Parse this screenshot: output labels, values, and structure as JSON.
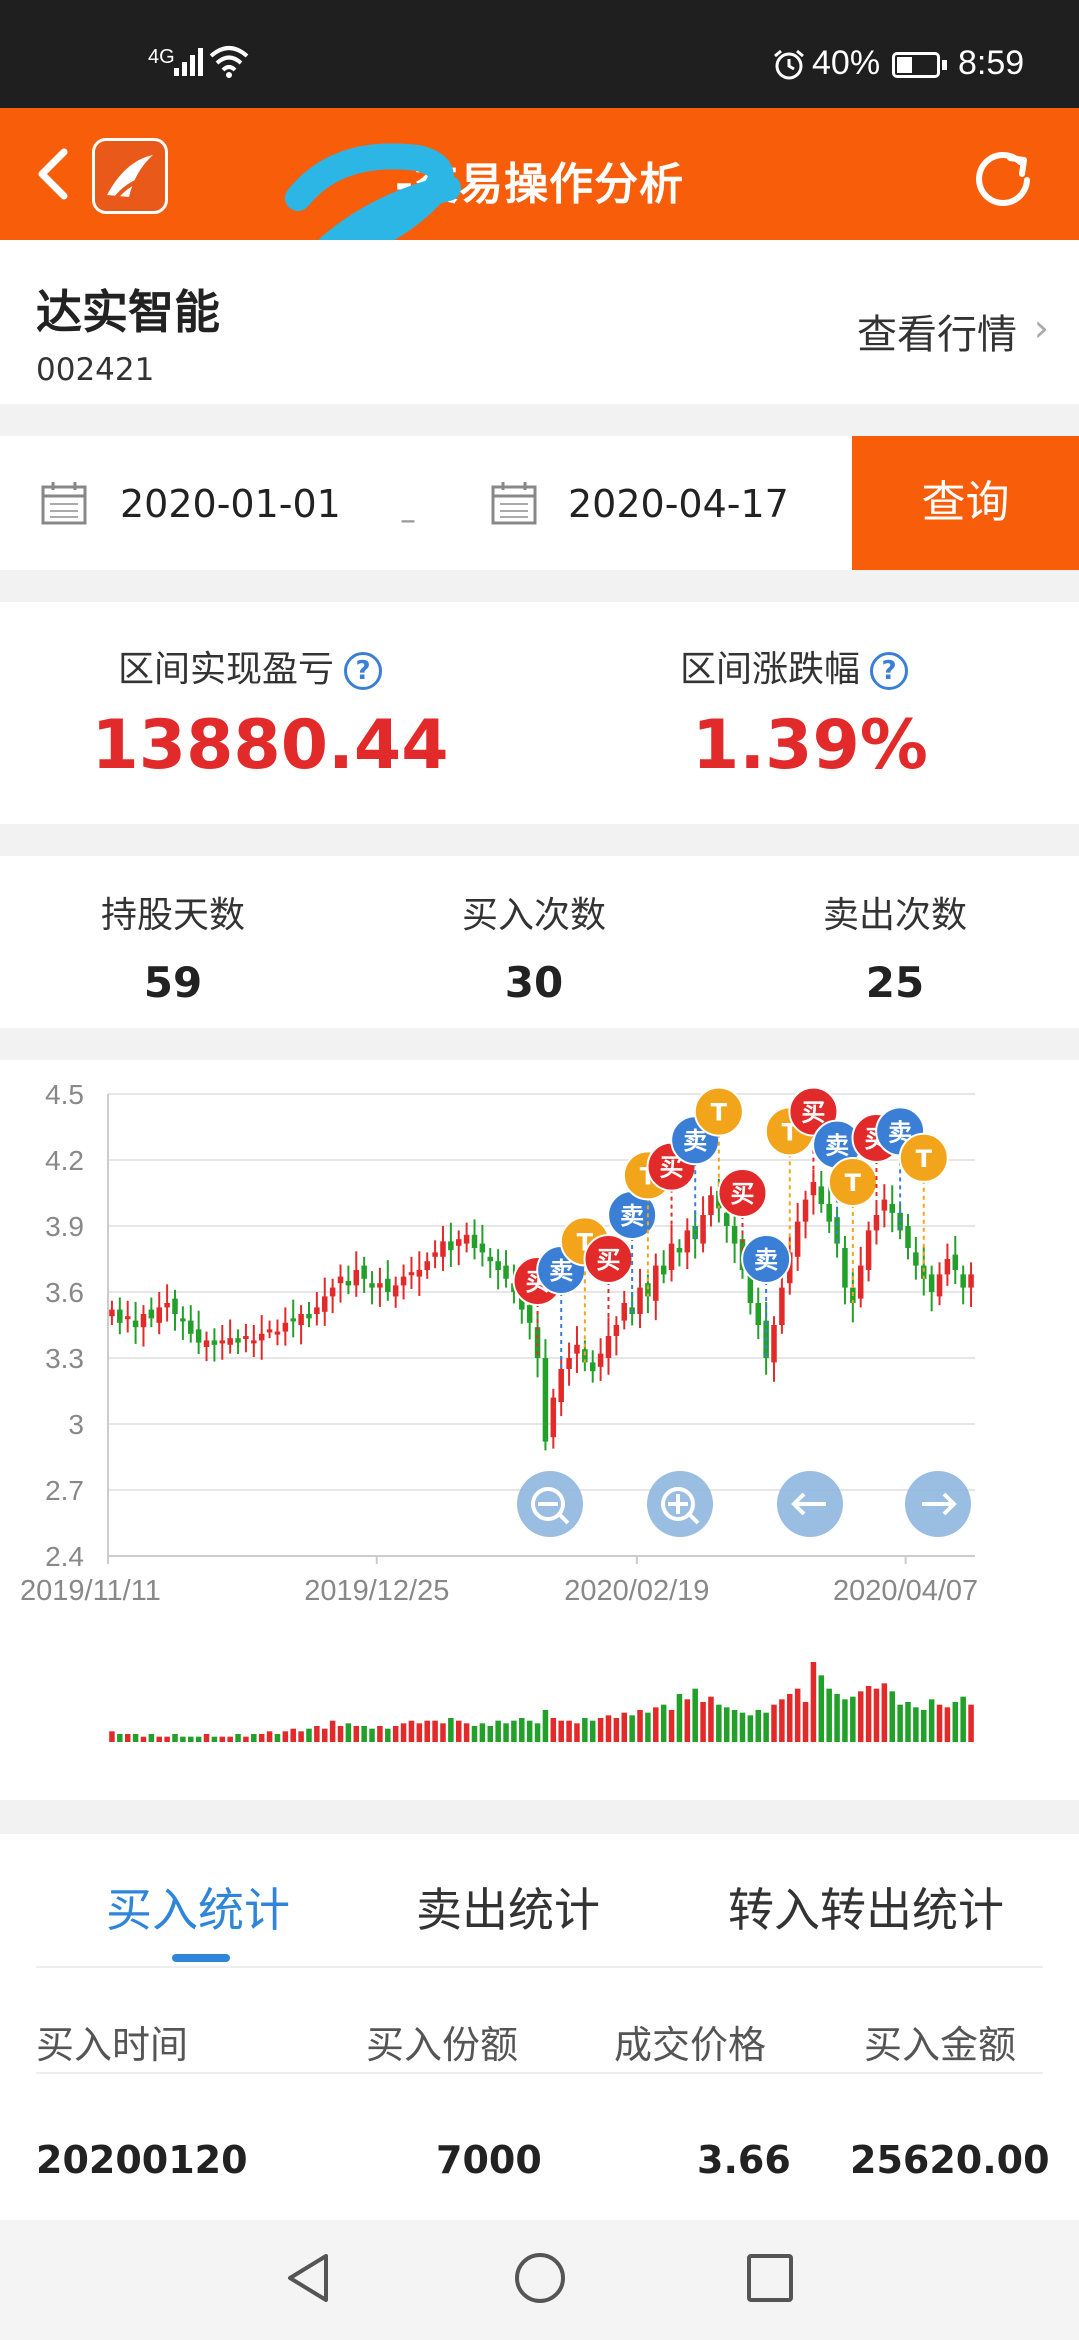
{
  "status_bar": {
    "network": "4G",
    "battery_pct": "40%",
    "battery_level": 0.4,
    "time": "8:59"
  },
  "header": {
    "title": "-交易操作分析",
    "accent": "#f85e09"
  },
  "stock": {
    "name": "达实智能",
    "code": "002421",
    "view_quote": "查看行情"
  },
  "date_range": {
    "start": "2020-01-01",
    "separator": "–",
    "end": "2020-04-17",
    "query_label": "查询"
  },
  "summary": {
    "pnl_label": "区间实现盈亏",
    "pnl_value": "13880.44",
    "change_label": "区间涨跌幅",
    "change_value": "1.39%",
    "help_glyph": "?"
  },
  "stats": [
    {
      "label": "持股天数",
      "value": "59"
    },
    {
      "label": "买入次数",
      "value": "30"
    },
    {
      "label": "卖出次数",
      "value": "25"
    }
  ],
  "chart_controls": {
    "zoom_out": "zoom-out-icon",
    "zoom_in": "zoom-in-icon",
    "left": "arrow-left-icon",
    "right": "arrow-right-icon"
  },
  "chart_data": {
    "type": "candlestick",
    "y_ticks": [
      "4.5",
      "4.2",
      "3.9",
      "3.6",
      "3.3",
      "3",
      "2.7",
      "2.4"
    ],
    "ylim": [
      2.4,
      4.5
    ],
    "x_ticks": [
      "2019/11/11",
      "2019/12/25",
      "2020/02/19",
      "2020/04/07"
    ],
    "up_color": "#e22a2a",
    "down_color": "#23a02a",
    "closes": [
      3.52,
      3.46,
      3.49,
      3.44,
      3.5,
      3.48,
      3.53,
      3.55,
      3.5,
      3.47,
      3.41,
      3.37,
      3.38,
      3.36,
      3.38,
      3.39,
      3.37,
      3.4,
      3.38,
      3.41,
      3.43,
      3.42,
      3.46,
      3.47,
      3.5,
      3.48,
      3.53,
      3.58,
      3.62,
      3.67,
      3.63,
      3.7,
      3.66,
      3.62,
      3.64,
      3.6,
      3.63,
      3.67,
      3.69,
      3.7,
      3.74,
      3.78,
      3.83,
      3.79,
      3.84,
      3.86,
      3.8,
      3.78,
      3.74,
      3.7,
      3.66,
      3.6,
      3.52,
      3.46,
      3.3,
      2.92,
      3.12,
      3.25,
      3.3,
      3.36,
      3.28,
      3.24,
      3.32,
      3.4,
      3.45,
      3.55,
      3.5,
      3.62,
      3.58,
      3.72,
      3.68,
      3.82,
      3.78,
      3.88,
      3.84,
      3.95,
      4.04,
      3.98,
      3.9,
      3.82,
      3.7,
      3.55,
      3.45,
      3.3,
      3.45,
      3.62,
      3.78,
      3.92,
      4.02,
      4.1,
      4.0,
      3.92,
      3.82,
      3.62,
      3.55,
      3.72,
      3.88,
      3.95,
      4.02,
      3.96,
      3.88,
      3.8,
      3.72,
      3.66,
      3.6,
      3.68,
      3.75,
      3.7,
      3.62,
      3.68
    ],
    "volumes": [
      4,
      3,
      3,
      3,
      2,
      3,
      2,
      2,
      3,
      2,
      2,
      2,
      3,
      2,
      2,
      2,
      3,
      2,
      3,
      3,
      4,
      3,
      4,
      5,
      4,
      5,
      6,
      5,
      8,
      6,
      7,
      6,
      6,
      5,
      6,
      5,
      6,
      7,
      8,
      7,
      8,
      8,
      7,
      9,
      8,
      7,
      6,
      7,
      6,
      8,
      7,
      8,
      9,
      8,
      7,
      12,
      9,
      8,
      8,
      7,
      9,
      8,
      9,
      10,
      9,
      11,
      10,
      12,
      11,
      13,
      14,
      12,
      18,
      16,
      20,
      15,
      17,
      14,
      13,
      12,
      11,
      10,
      12,
      11,
      14,
      16,
      18,
      20,
      15,
      30,
      25,
      20,
      18,
      16,
      17,
      19,
      21,
      20,
      22,
      19,
      14,
      15,
      13,
      12,
      16,
      14,
      13,
      15,
      17,
      14
    ],
    "trade_markers": [
      {
        "label": "买",
        "color": "#e22a2a",
        "date": "2020/01/20"
      },
      {
        "label": "卖",
        "color": "#3a7fd5"
      },
      {
        "label": "T",
        "color": "#f2a51a"
      },
      {
        "label": "买",
        "color": "#e22a2a"
      },
      {
        "label": "卖",
        "color": "#3a7fd5"
      },
      {
        "label": "T",
        "color": "#f2a51a"
      },
      {
        "label": "买",
        "color": "#e22a2a"
      },
      {
        "label": "卖",
        "color": "#3a7fd5"
      },
      {
        "label": "T",
        "color": "#f2a51a"
      },
      {
        "label": "买",
        "color": "#e22a2a"
      },
      {
        "label": "卖",
        "color": "#3a7fd5"
      },
      {
        "label": "T",
        "color": "#f2a51a"
      },
      {
        "label": "买",
        "color": "#e22a2a"
      },
      {
        "label": "卖",
        "color": "#3a7fd5"
      },
      {
        "label": "T",
        "color": "#f2a51a"
      },
      {
        "label": "买",
        "color": "#e22a2a"
      },
      {
        "label": "卖",
        "color": "#3a7fd5"
      },
      {
        "label": "T",
        "color": "#f2a51a"
      }
    ]
  },
  "tabs": [
    {
      "label": "买入统计",
      "active": true
    },
    {
      "label": "卖出统计",
      "active": false
    },
    {
      "label": "转入转出统计",
      "active": false
    }
  ],
  "table": {
    "headers": [
      "买入时间",
      "买入份额",
      "成交价格",
      "买入金额"
    ],
    "rows": [
      [
        "20200120",
        "7000",
        "3.66",
        "25620.00"
      ]
    ]
  }
}
